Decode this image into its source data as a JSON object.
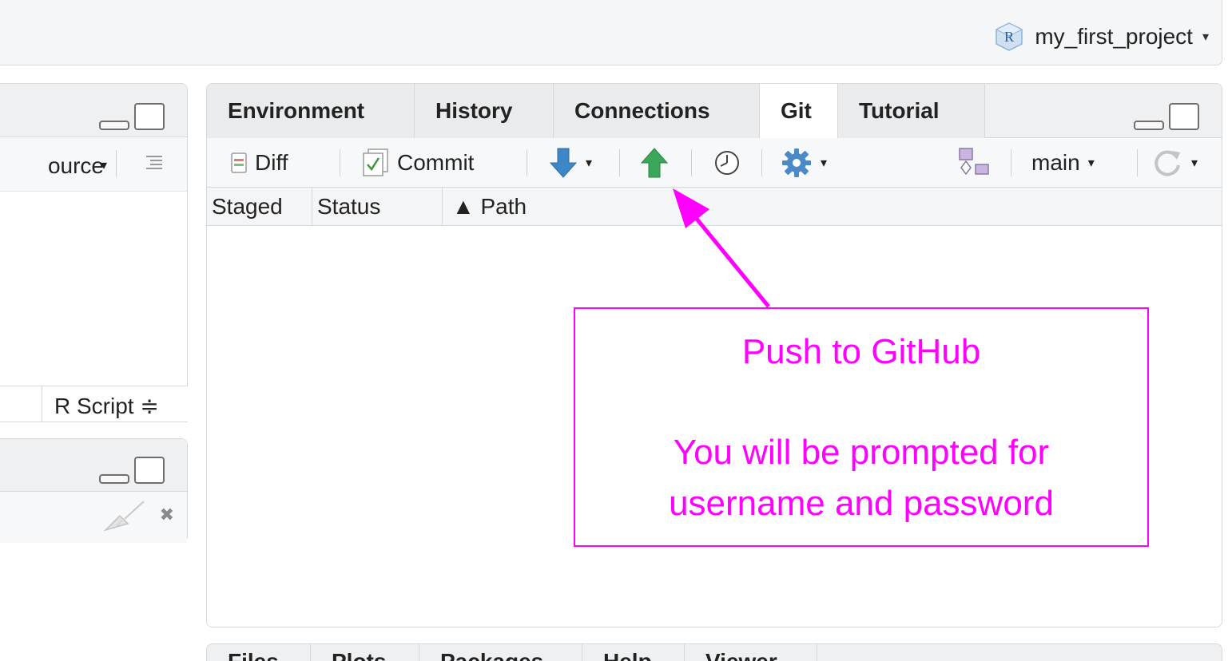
{
  "topbar": {
    "project_name": "my_first_project",
    "project_icon": "r-project-icon"
  },
  "left": {
    "source_label": "ource",
    "script_type": "R Script ≑"
  },
  "tabs": [
    {
      "label": "Environment",
      "active": false
    },
    {
      "label": "History",
      "active": false
    },
    {
      "label": "Connections",
      "active": false
    },
    {
      "label": "Git",
      "active": true
    },
    {
      "label": "Tutorial",
      "active": false
    }
  ],
  "git_toolbar": {
    "diff_label": "Diff",
    "commit_label": "Commit",
    "branch_label": "main",
    "pull_icon": "blue-down-arrow-icon",
    "push_icon": "green-up-arrow-icon",
    "history_icon": "clock-icon",
    "settings_icon": "gear-icon",
    "new_branch_icon": "new-branch-icon",
    "refresh_icon": "refresh-icon"
  },
  "columns": {
    "staged": "Staged",
    "status": "Status",
    "path": "▲ Path"
  },
  "annotation": {
    "title": "Push to GitHub",
    "line2": "You will be prompted for",
    "line3": "username and password",
    "color": "#ff00ff"
  },
  "bottom_tabs": [
    "Files",
    "Plots",
    "Packages",
    "Help",
    "Viewer"
  ],
  "colors": {
    "accent_annotation": "#ff00ff",
    "pull_blue": "#3d87c7",
    "push_green": "#3aa75a"
  }
}
